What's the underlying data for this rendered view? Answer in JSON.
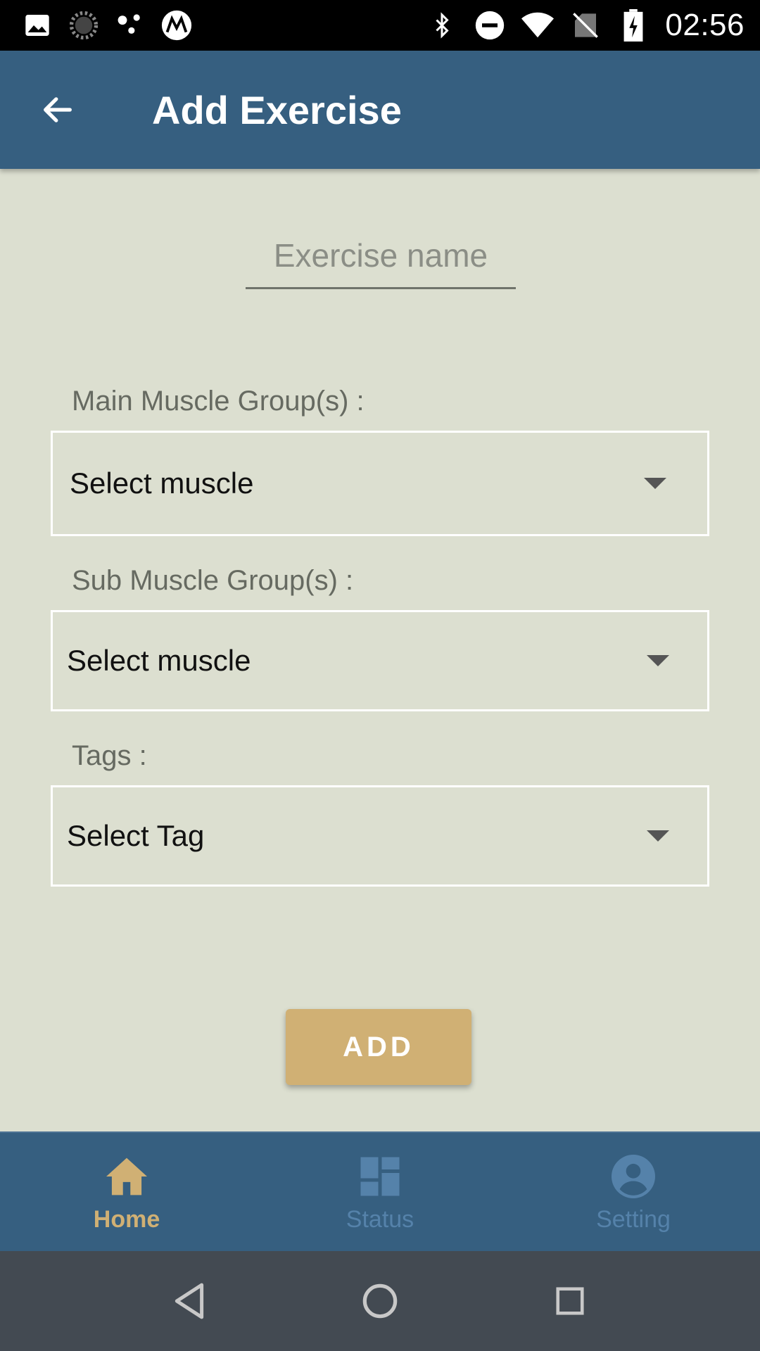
{
  "status_bar": {
    "time": "02:56",
    "left_icons": [
      "image-icon",
      "spinner-icon",
      "dots-icon",
      "motorola-icon"
    ],
    "right_icons": [
      "bluetooth-icon",
      "do-not-disturb-icon",
      "wifi-icon",
      "no-sim-icon",
      "battery-charging-icon"
    ]
  },
  "app_bar": {
    "title": "Add Exercise",
    "back_icon": "arrow-left-icon"
  },
  "form": {
    "exercise_name_placeholder": "Exercise name",
    "exercise_name_value": "",
    "main_muscle_label": "Main Muscle Group(s) :",
    "main_muscle_value": "Select muscle",
    "sub_muscle_label": "Sub Muscle Group(s) :",
    "sub_muscle_value": "Select muscle",
    "tags_label": "Tags :",
    "tags_value": "Select Tag",
    "add_label": "ADD"
  },
  "bottom_nav": {
    "items": [
      {
        "label": "Home",
        "icon": "home-icon",
        "active": true
      },
      {
        "label": "Status",
        "icon": "dashboard-icon",
        "active": false
      },
      {
        "label": "Setting",
        "icon": "account-circle-icon",
        "active": false
      }
    ]
  },
  "colors": {
    "primary": "#365f80",
    "accent": "#d0b074",
    "background": "#dcdfd0",
    "inactive_nav": "#5582aa"
  }
}
